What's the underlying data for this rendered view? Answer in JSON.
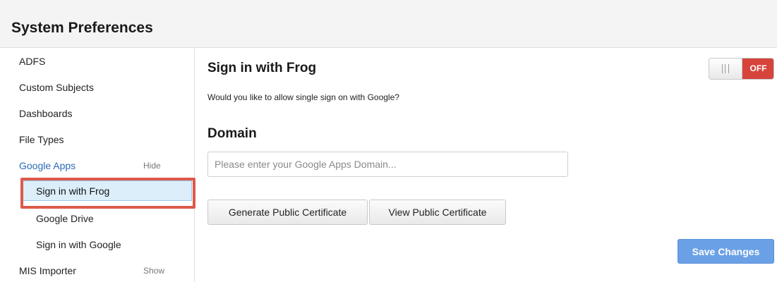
{
  "header": {
    "title": "System Preferences"
  },
  "sidebar": {
    "items": [
      {
        "label": "ADFS"
      },
      {
        "label": "Custom Subjects"
      },
      {
        "label": "Dashboards"
      },
      {
        "label": "File Types"
      },
      {
        "label": "Google Apps",
        "aside": "Hide"
      },
      {
        "label": "Sign in with Frog"
      },
      {
        "label": "Google Drive"
      },
      {
        "label": "Sign in with Google"
      },
      {
        "label": "MIS Importer",
        "aside": "Show"
      }
    ]
  },
  "main": {
    "title": "Sign in with Frog",
    "description": "Would you like to allow single sign on with Google?",
    "toggle": {
      "state_label": "OFF"
    },
    "domain": {
      "title": "Domain",
      "placeholder": "Please enter your Google Apps Domain...",
      "value": ""
    },
    "buttons": {
      "generate": "Generate Public Certificate",
      "view": "View Public Certificate",
      "save": "Save Changes"
    }
  },
  "colors": {
    "accent": "#2a6ab8",
    "highlight": "#dc5a4a",
    "toggle_off": "#d6443b",
    "primary_button": "#6aa0e6",
    "selected_bg": "#dbeefa"
  }
}
